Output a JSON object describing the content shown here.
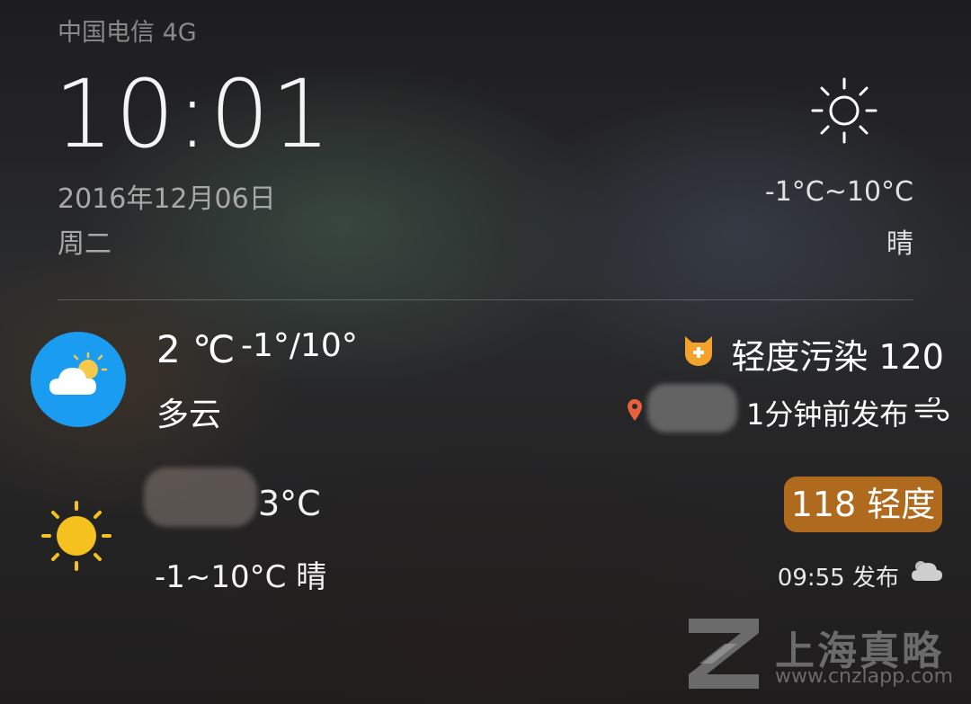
{
  "status_bar": {
    "carrier": "中国电信 4G"
  },
  "lock_clock": {
    "time": "10:01",
    "date": "2016年12月06日",
    "weekday": "周二",
    "icon": "sun-icon",
    "temp_range": "-1°C~10°C",
    "condition": "晴"
  },
  "weather_card": {
    "icon": "partly-cloudy-icon",
    "icon_bg_color": "#1a9df0",
    "current_temp": "2 ℃",
    "temp_range": "-1°/10°",
    "condition": "多云",
    "aqi_text": "轻度污染 120",
    "aqi_icon_color": "#f3a22b",
    "publish_time": "1分钟前发布"
  },
  "city_card": {
    "icon": "sun-icon",
    "temp": "3°C",
    "range": "-1~10°C  晴",
    "aqi_badge": "118 轻度",
    "aqi_badge_color": "#b06a1e",
    "publish_time": "09:55 发布"
  },
  "watermark": {
    "text": "上海真略",
    "url": "www.cnzlapp.com"
  }
}
